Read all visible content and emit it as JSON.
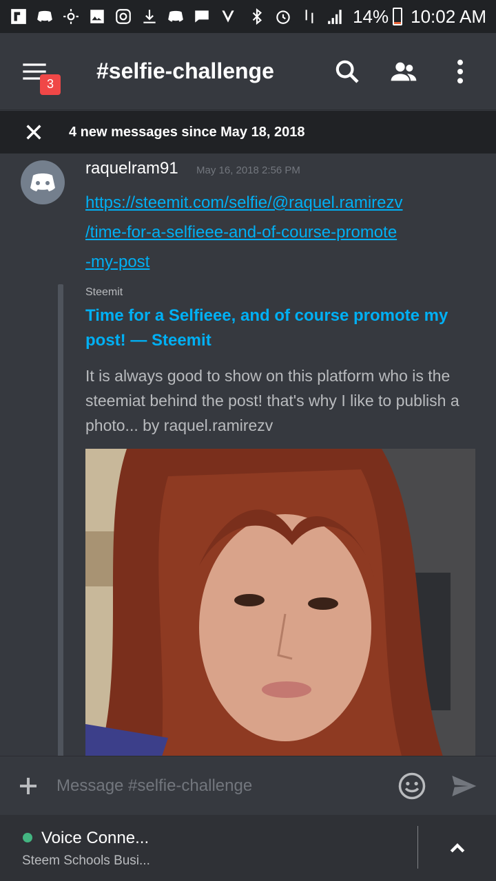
{
  "status_bar": {
    "battery": "14%",
    "time": "10:02 AM",
    "notification_icons": [
      "flipboard-icon",
      "discord-icon",
      "weather-icon",
      "image-icon",
      "instagram-icon",
      "download-icon",
      "discord-icon",
      "chat-icon",
      "check-icon"
    ],
    "system_icons": [
      "bluetooth-icon",
      "alarm-icon",
      "4g-lte-icon",
      "signal-icon",
      "battery-icon"
    ]
  },
  "header": {
    "title": "#selfie-challenge",
    "menu_badge": "3"
  },
  "banner": {
    "text": "4 new messages since May 18, 2018"
  },
  "message": {
    "author": "raquelram91",
    "timestamp": "May 16, 2018 2:56 PM",
    "link_lines": [
      "https://steemit.com/selfie/@raquel.ramirezv",
      "/time-for-a-selfieee-and-of-course-promote",
      "-my-post"
    ],
    "embed": {
      "provider": "Steemit",
      "title": "Time for a Selfieee, and of course promote my post! — Steemit",
      "description": "It is always good to show on this platform who is the steemiat behind the post! that's why I like to publish a photo... by raquel.ramirezv"
    }
  },
  "composer": {
    "placeholder": "Message #selfie-challenge"
  },
  "voice": {
    "title": "Voice Conne...",
    "subtitle": "Steem Schools Busi..."
  },
  "colors": {
    "background": "#36393f",
    "link": "#00b0f4",
    "badge": "#f04747",
    "voice_dot": "#43b581"
  }
}
